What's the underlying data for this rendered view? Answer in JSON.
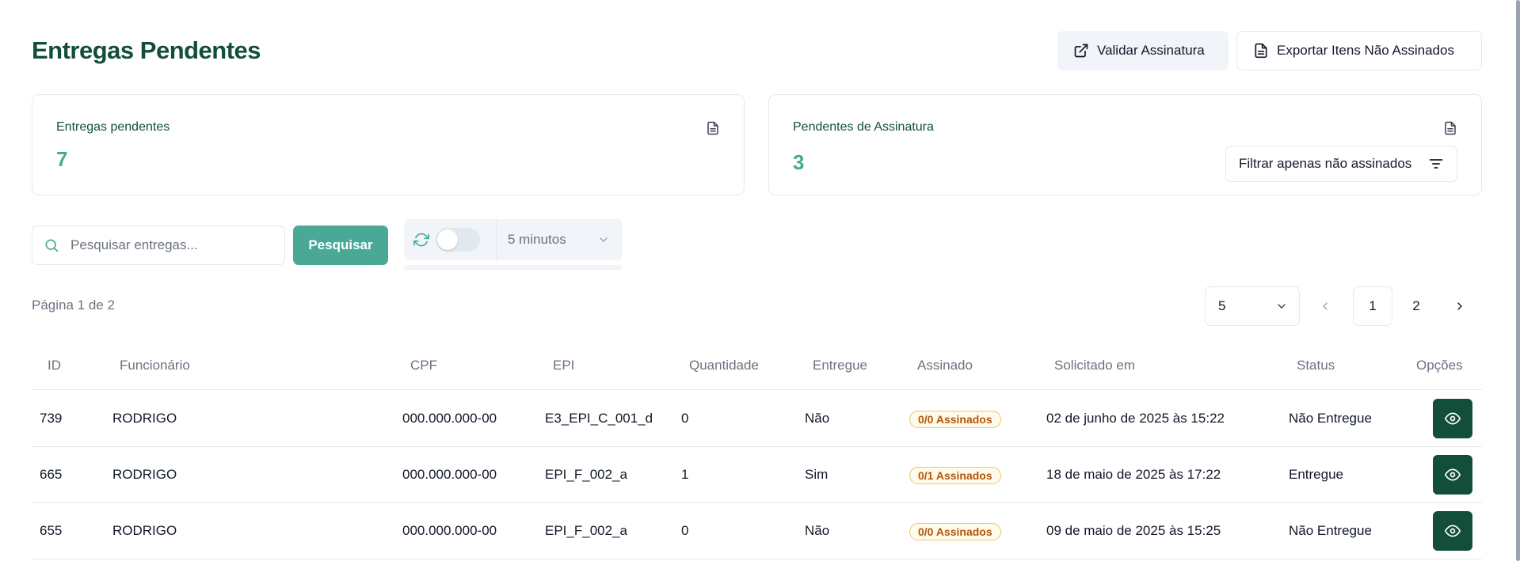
{
  "header": {
    "title": "Entregas Pendentes",
    "validar_label": "Validar Assinatura",
    "exportar_label": "Exportar Itens Não Assinados"
  },
  "cards": {
    "entregas": {
      "label": "Entregas pendentes",
      "value": "7",
      "icon": "file-text-icon"
    },
    "assinatura": {
      "label": "Pendentes de Assinatura",
      "value": "3",
      "icon": "file-text-icon",
      "filter_label": "Filtrar apenas não assinados"
    }
  },
  "search": {
    "placeholder": "Pesquisar entregas...",
    "value": "",
    "button_label": "Pesquisar"
  },
  "auto_refresh": {
    "enabled": false,
    "interval": "5 minutos"
  },
  "pagination": {
    "info": "Página 1 de 2",
    "page_size": "5",
    "pages": [
      "1",
      "2"
    ],
    "current": "1"
  },
  "table": {
    "columns": [
      "ID",
      "Funcionário",
      "CPF",
      "EPI",
      "Quantidade",
      "Entregue",
      "Assinado",
      "Solicitado em",
      "Status",
      "Opções"
    ],
    "rows": [
      {
        "id": "739",
        "funcionario": "RODRIGO",
        "cpf": "000.000.000-00",
        "epi": "E3_EPI_C_001_d",
        "quantidade": "0",
        "entregue": "Não",
        "assinado": "0/0 Assinados",
        "solicitado": "02 de junho de 2025 às 15:22",
        "status": "Não Entregue"
      },
      {
        "id": "665",
        "funcionario": "RODRIGO",
        "cpf": "000.000.000-00",
        "epi": "EPI_F_002_a",
        "quantidade": "1",
        "entregue": "Sim",
        "assinado": "0/1 Assinados",
        "solicitado": "18 de maio de 2025 às 17:22",
        "status": "Entregue"
      },
      {
        "id": "655",
        "funcionario": "RODRIGO",
        "cpf": "000.000.000-00",
        "epi": "EPI_F_002_a",
        "quantidade": "0",
        "entregue": "Não",
        "assinado": "0/0 Assinados",
        "solicitado": "09 de maio de 2025 às 15:25",
        "status": "Não Entregue"
      }
    ]
  },
  "colors": {
    "brand_dark": "#134e3a",
    "brand_accent": "#4aa996",
    "badge_warning": "#b45309"
  }
}
